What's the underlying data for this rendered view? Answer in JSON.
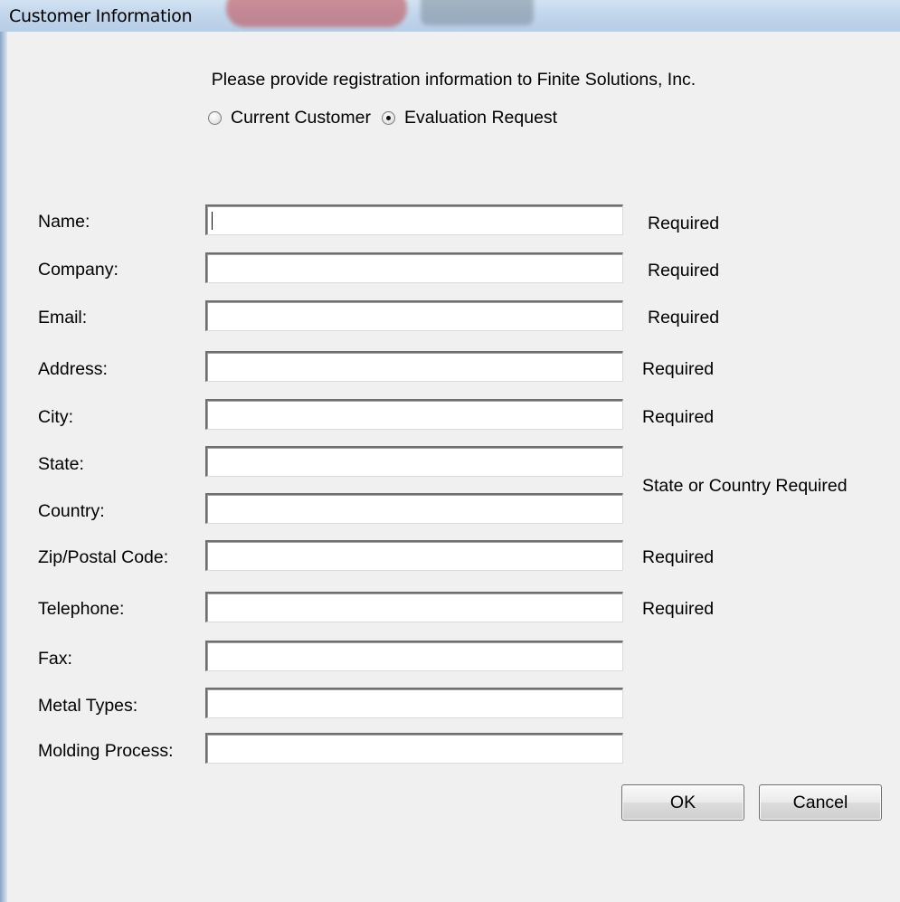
{
  "window": {
    "title": "Customer Information"
  },
  "intro": "Please provide registration information to Finite Solutions, Inc.",
  "customer_type": {
    "options": [
      {
        "label": "Current Customer",
        "selected": false
      },
      {
        "label": "Evaluation Request",
        "selected": true
      }
    ]
  },
  "fields": {
    "name": {
      "label": "Name:",
      "value": "",
      "note": "Required",
      "focused": true
    },
    "company": {
      "label": "Company:",
      "value": "",
      "note": "Required"
    },
    "email": {
      "label": "Email:",
      "value": "",
      "note": "Required"
    },
    "address": {
      "label": "Address:",
      "value": "",
      "note": "Required"
    },
    "city": {
      "label": "City:",
      "value": "",
      "note": "Required"
    },
    "state": {
      "label": "State:",
      "value": ""
    },
    "country": {
      "label": "Country:",
      "value": ""
    },
    "zip": {
      "label": "Zip/Postal Code:",
      "value": "",
      "note": "Required"
    },
    "telephone": {
      "label": "Telephone:",
      "value": "",
      "note": "Required"
    },
    "fax": {
      "label": "Fax:",
      "value": ""
    },
    "metal": {
      "label": "Metal Types:",
      "value": ""
    },
    "molding": {
      "label": "Molding Process:",
      "value": ""
    }
  },
  "state_country_note": "State or Country Required",
  "buttons": {
    "ok": "OK",
    "cancel": "Cancel"
  },
  "colors": {
    "titlebar": "#c2d6ec",
    "dialog_bg": "#f0f0f0",
    "field_bg": "#ffffff"
  }
}
